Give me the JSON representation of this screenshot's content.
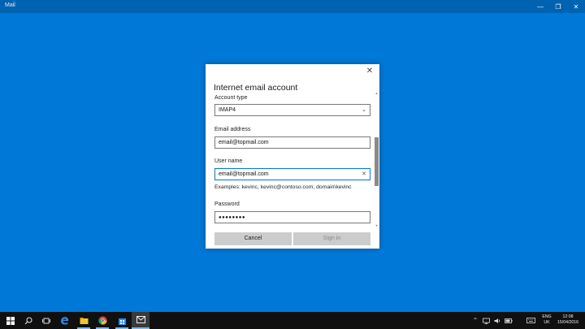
{
  "window": {
    "title": "Mail",
    "min_glyph": "—",
    "max_glyph": "❐",
    "close_glyph": "✕"
  },
  "dialog": {
    "title": "Internet email account",
    "close_glyph": "✕",
    "account_type": {
      "label": "Account type",
      "value": "IMAP4"
    },
    "email": {
      "label": "Email address",
      "value": "email@topmail.com"
    },
    "username": {
      "label": "User name",
      "value": "email@topmail.com",
      "hint": "Examples: kevinc, kevinc@contoso.com, domain\\kevinc"
    },
    "password": {
      "label": "Password",
      "value": "●●●●●●●●"
    },
    "cancel_label": "Cancel",
    "signin_label": "Sign in"
  },
  "taskbar": {
    "lang_top": "ENG",
    "lang_bottom": "UK",
    "time": "12:08",
    "date": "15/04/2016",
    "items": [
      "windows-logo-icon",
      "search-icon",
      "task-view-icon",
      "edge-icon",
      "file-explorer-icon",
      "chrome-icon",
      "store-icon",
      "mail-icon"
    ],
    "tray_icons": [
      "chevron-up-icon",
      "network-icon",
      "volume-icon",
      "battery-icon",
      "keyboard-icon"
    ]
  },
  "colors": {
    "desktop_blue": "#0078d7",
    "titlebar_blue": "#0063b1",
    "taskbar_black": "#101010",
    "focus_blue": "#0078d7"
  }
}
